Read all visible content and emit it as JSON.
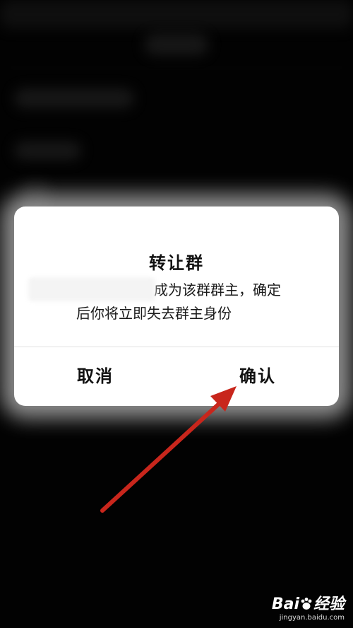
{
  "dialog": {
    "title": "转让群",
    "message_line1": "成为该群群主，确定",
    "message_line2": "后你将立即失去群主身份",
    "cancel_label": "取消",
    "confirm_label": "确认"
  },
  "annotation": {
    "icon": "red-arrow-icon",
    "color": "#c8261c"
  },
  "watermark": {
    "brand": "Bai",
    "brand_suffix": "经验",
    "url": "jingyan.baidu.com"
  }
}
